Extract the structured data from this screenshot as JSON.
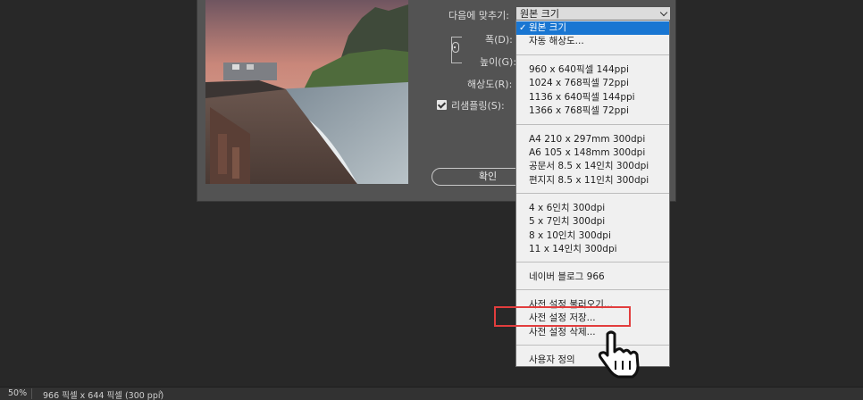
{
  "dialog": {
    "fit_label": "다음에 맞추기:",
    "fit_value": "원본 크기",
    "width_label": "폭(D):",
    "height_label": "높이(G):",
    "resolution_label": "해상도(R):",
    "resample_label": "리샘플링(S):",
    "resample_checked": true,
    "ok_label": "확인"
  },
  "dropdown": {
    "items": [
      {
        "label": "원본 크기",
        "selected": true
      },
      {
        "label": "자동 해상도..."
      },
      {
        "label": "960 x 640픽셀 144ppi"
      },
      {
        "label": "1024 x 768픽셀 72ppi"
      },
      {
        "label": "1136 x 640픽셀 144ppi"
      },
      {
        "label": "1366 x 768픽셀 72ppi"
      },
      {
        "label": "A4 210 x 297mm 300dpi"
      },
      {
        "label": "A6 105 x 148mm 300dpi"
      },
      {
        "label": "공문서 8.5 x 14인치 300dpi"
      },
      {
        "label": "편지지 8.5 x 11인치 300dpi"
      },
      {
        "label": "4 x 6인치 300dpi"
      },
      {
        "label": "5 x 7인치 300dpi"
      },
      {
        "label": "8 x 10인치 300dpi"
      },
      {
        "label": "11 x 14인치 300dpi"
      },
      {
        "label": "네이버 블로그 966"
      },
      {
        "label": "사전 설정 불러오기..."
      },
      {
        "label": "사전 설정 저장..."
      },
      {
        "label": "사전 설정 삭제..."
      },
      {
        "label": "사용자 정의"
      }
    ],
    "check_mark": "✓"
  },
  "statusbar": {
    "zoom": "50%",
    "doc_info": "966 픽셀 x 644 픽셀 (300 ppi)",
    "arrow": "›"
  },
  "colors": {
    "selection": "#1976d2",
    "highlight": "#e23d3d"
  }
}
